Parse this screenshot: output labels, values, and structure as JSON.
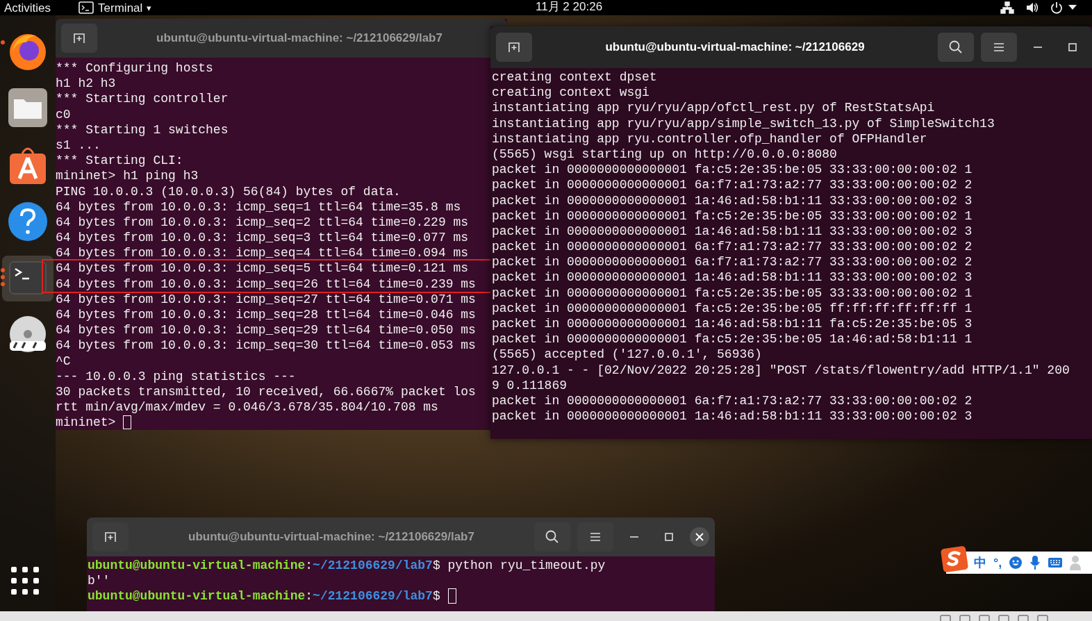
{
  "top_bar": {
    "activities": "Activities",
    "app_menu": {
      "label": "Terminal",
      "caret": "▾"
    },
    "clock": "11月 2  20:26"
  },
  "dock": {
    "items": [
      {
        "kind": "firefox",
        "running": true
      },
      {
        "kind": "files",
        "running": false
      },
      {
        "kind": "software",
        "running": false
      },
      {
        "kind": "help",
        "running": false
      },
      {
        "kind": "terminal",
        "running": true
      },
      {
        "kind": "dvd",
        "running": false
      }
    ]
  },
  "windows": [
    {
      "title": "ubuntu@ubuntu-virtual-machine: ~/212106629/lab7",
      "focused": false,
      "lines": [
        {
          "text": "*** Configuring hosts",
          "highlighted": false
        },
        {
          "text": "h1 h2 h3",
          "highlighted": false
        },
        {
          "text": "*** Starting controller",
          "highlighted": false
        },
        {
          "text": "c0",
          "highlighted": false
        },
        {
          "text": "*** Starting 1 switches",
          "highlighted": false
        },
        {
          "text": "s1 ...",
          "highlighted": false
        },
        {
          "text": "*** Starting CLI:",
          "highlighted": false
        },
        {
          "text": "mininet> h1 ping h3",
          "highlighted": false
        },
        {
          "text": "PING 10.0.0.3 (10.0.0.3) 56(84) bytes of data.",
          "highlighted": false
        },
        {
          "text": "64 bytes from 10.0.0.3: icmp_seq=1 ttl=64 time=35.8 ms",
          "highlighted": false
        },
        {
          "text": "64 bytes from 10.0.0.3: icmp_seq=2 ttl=64 time=0.229 ms",
          "highlighted": false
        },
        {
          "text": "64 bytes from 10.0.0.3: icmp_seq=3 ttl=64 time=0.077 ms",
          "highlighted": false
        },
        {
          "text": "64 bytes from 10.0.0.3: icmp_seq=4 ttl=64 time=0.094 ms",
          "highlighted": false
        },
        {
          "text": "64 bytes from 10.0.0.3: icmp_seq=5 ttl=64 time=0.121 ms",
          "highlighted": true
        },
        {
          "text": "64 bytes from 10.0.0.3: icmp_seq=26 ttl=64 time=0.239 ms",
          "highlighted": true
        },
        {
          "text": "64 bytes from 10.0.0.3: icmp_seq=27 ttl=64 time=0.071 ms",
          "highlighted": false
        },
        {
          "text": "64 bytes from 10.0.0.3: icmp_seq=28 ttl=64 time=0.046 ms",
          "highlighted": false
        },
        {
          "text": "64 bytes from 10.0.0.3: icmp_seq=29 ttl=64 time=0.050 ms",
          "highlighted": false
        },
        {
          "text": "64 bytes from 10.0.0.3: icmp_seq=30 ttl=64 time=0.053 ms",
          "highlighted": false
        },
        {
          "text": "^C",
          "highlighted": false
        },
        {
          "text": "--- 10.0.0.3 ping statistics ---",
          "highlighted": false
        },
        {
          "text": "30 packets transmitted, 10 received, 66.6667% packet los",
          "highlighted": false
        },
        {
          "text": "rtt min/avg/max/mdev = 0.046/3.678/35.804/10.708 ms",
          "highlighted": false
        },
        {
          "text": "mininet> ",
          "highlighted": false,
          "cursor": true
        }
      ]
    },
    {
      "title": "ubuntu@ubuntu-virtual-machine: ~/212106629",
      "focused": true,
      "lines": [
        {
          "text": "creating context dpset",
          "highlighted": false
        },
        {
          "text": "creating context wsgi",
          "highlighted": false
        },
        {
          "text": "instantiating app ryu/ryu/app/ofctl_rest.py of RestStatsApi",
          "highlighted": false
        },
        {
          "text": "instantiating app ryu/ryu/app/simple_switch_13.py of SimpleSwitch13",
          "highlighted": false
        },
        {
          "text": "instantiating app ryu.controller.ofp_handler of OFPHandler",
          "highlighted": false
        },
        {
          "text": "(5565) wsgi starting up on http://0.0.0.0:8080",
          "highlighted": false
        },
        {
          "text": "packet in 0000000000000001 fa:c5:2e:35:be:05 33:33:00:00:00:02 1",
          "highlighted": false
        },
        {
          "text": "packet in 0000000000000001 6a:f7:a1:73:a2:77 33:33:00:00:00:02 2",
          "highlighted": false
        },
        {
          "text": "packet in 0000000000000001 1a:46:ad:58:b1:11 33:33:00:00:00:02 3",
          "highlighted": false
        },
        {
          "text": "packet in 0000000000000001 fa:c5:2e:35:be:05 33:33:00:00:00:02 1",
          "highlighted": false
        },
        {
          "text": "packet in 0000000000000001 1a:46:ad:58:b1:11 33:33:00:00:00:02 3",
          "highlighted": false
        },
        {
          "text": "packet in 0000000000000001 6a:f7:a1:73:a2:77 33:33:00:00:00:02 2",
          "highlighted": false
        },
        {
          "text": "packet in 0000000000000001 6a:f7:a1:73:a2:77 33:33:00:00:00:02 2",
          "highlighted": false
        },
        {
          "text": "packet in 0000000000000001 1a:46:ad:58:b1:11 33:33:00:00:00:02 3",
          "highlighted": false
        },
        {
          "text": "packet in 0000000000000001 fa:c5:2e:35:be:05 33:33:00:00:00:02 1",
          "highlighted": false
        },
        {
          "text": "packet in 0000000000000001 fa:c5:2e:35:be:05 ff:ff:ff:ff:ff:ff 1",
          "highlighted": false
        },
        {
          "text": "packet in 0000000000000001 1a:46:ad:58:b1:11 fa:c5:2e:35:be:05 3",
          "highlighted": false
        },
        {
          "text": "packet in 0000000000000001 fa:c5:2e:35:be:05 1a:46:ad:58:b1:11 1",
          "highlighted": false
        },
        {
          "text": "(5565) accepted ('127.0.0.1', 56936)",
          "highlighted": false
        },
        {
          "text": "127.0.0.1 - - [02/Nov/2022 20:25:28] \"POST /stats/flowentry/add HTTP/1.1\" 200",
          "highlighted": false
        },
        {
          "text": "9 0.111869",
          "highlighted": false
        },
        {
          "text": "packet in 0000000000000001 6a:f7:a1:73:a2:77 33:33:00:00:00:02 2",
          "highlighted": false
        },
        {
          "text": "packet in 0000000000000001 1a:46:ad:58:b1:11 33:33:00:00:00:02 3",
          "highlighted": false
        }
      ]
    },
    {
      "title": "ubuntu@ubuntu-virtual-machine: ~/212106629/lab7",
      "focused": false,
      "prompt_lines": [
        {
          "kind": "prompt",
          "user_host": "ubuntu@ubuntu-virtual-machine",
          "separator": ":",
          "path": "~/212106629/lab7",
          "symbol": "$",
          "command": " python ryu_timeout.py"
        },
        {
          "kind": "output",
          "text": "b''"
        },
        {
          "kind": "prompt",
          "user_host": "ubuntu@ubuntu-virtual-machine",
          "separator": ":",
          "path": "~/212106629/lab7",
          "symbol": "$",
          "cursor": true
        }
      ]
    }
  ],
  "ime_bar": {
    "mode": "中",
    "punctuation": "°,"
  }
}
